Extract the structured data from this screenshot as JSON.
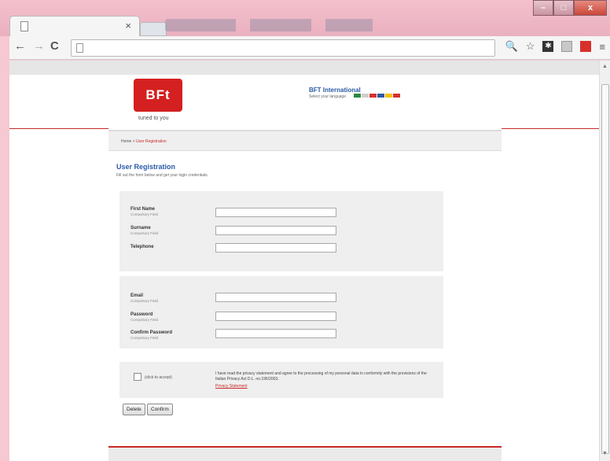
{
  "browser": {
    "tab_title": "",
    "tab_close": "×",
    "url": "",
    "nav": {
      "back": "←",
      "forward": "→",
      "reload": "C"
    },
    "window_buttons": {
      "minimize": "–",
      "maximize": "□",
      "close": "x"
    },
    "toolbar_icons": [
      "search-icon",
      "star-icon",
      "extension-icon",
      "extension-icon",
      "extension-icon",
      "menu-icon"
    ]
  },
  "header": {
    "logo_text": "BFt",
    "tagline": "tuned to you",
    "brand_title": "BFT International",
    "language_label": "Select your language",
    "flag_colors": [
      "#2a8a3e",
      "#cfcfcf",
      "#d7312b",
      "#2b5aa8",
      "#f2c400",
      "#d7312b"
    ]
  },
  "breadcrumb": {
    "home": "Home",
    "separator": ">",
    "current": "User Registration"
  },
  "page": {
    "title": "User Registration",
    "intro": "Fill out the form below and get your login credentials."
  },
  "personal_fields": [
    {
      "label": "First Name",
      "sublabel": "Compulsory Field",
      "value": ""
    },
    {
      "label": "Surname",
      "sublabel": "Compulsory Field",
      "value": ""
    },
    {
      "label": "Telephone",
      "sublabel": "",
      "value": ""
    }
  ],
  "account_fields": [
    {
      "label": "Email",
      "sublabel": "Compulsory Field",
      "value": ""
    },
    {
      "label": "Password",
      "sublabel": "Compulsory Field",
      "value": ""
    },
    {
      "label": "Confirm Password",
      "sublabel": "Compulsory Field",
      "value": ""
    }
  ],
  "privacy": {
    "click_label": "(click to accept)",
    "statement": "I have read the privacy statement and agree to the processing of my personal data in conformity with the provisions of the Italian Privacy Act D.L. no.196/2003.",
    "link": "Privacy Statement"
  },
  "buttons": {
    "delete": "Delete",
    "confirm": "Confirm"
  },
  "colors": {
    "brand_red": "#d42020",
    "link_blue": "#2b5aa8"
  }
}
